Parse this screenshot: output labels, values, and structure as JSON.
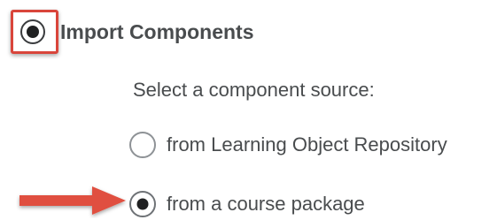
{
  "section": {
    "title": "Import Components",
    "selected": true
  },
  "source": {
    "prompt": "Select a component source:",
    "options": [
      {
        "label": "from Learning Object Repository",
        "selected": false
      },
      {
        "label": "from a course package",
        "selected": true
      }
    ]
  },
  "colors": {
    "text": "#494c4e",
    "highlight": "#d9453b",
    "arrow": "#e0503f",
    "radio_fill": "#202122"
  },
  "icons": {
    "callout": "arrow-right-icon"
  }
}
